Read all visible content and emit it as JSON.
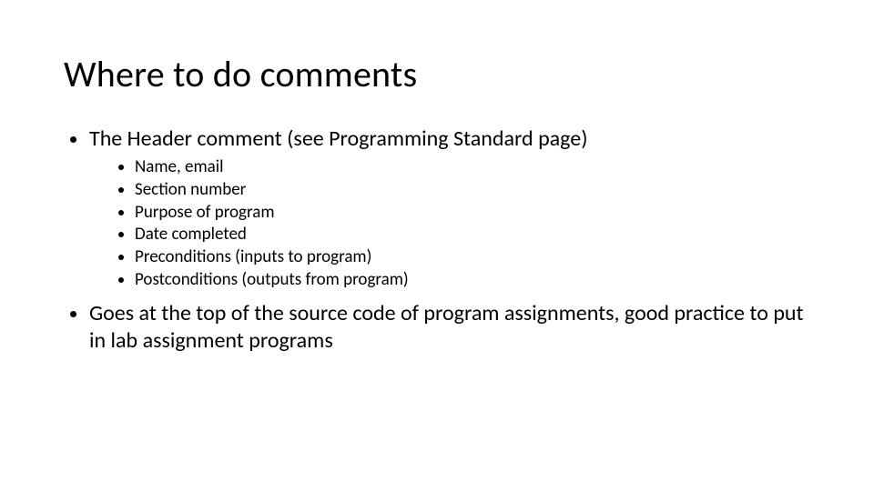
{
  "title": "Where to do comments",
  "bullets": [
    {
      "text": "The Header comment (see Programming Standard page)",
      "sub": [
        "Name, email",
        "Section number",
        "Purpose of program",
        "Date completed",
        "Preconditions (inputs to program)",
        "Postconditions (outputs from program)"
      ]
    },
    {
      "text": "Goes at the top of the source code of program assignments, good practice to put in lab assignment programs",
      "sub": []
    }
  ]
}
